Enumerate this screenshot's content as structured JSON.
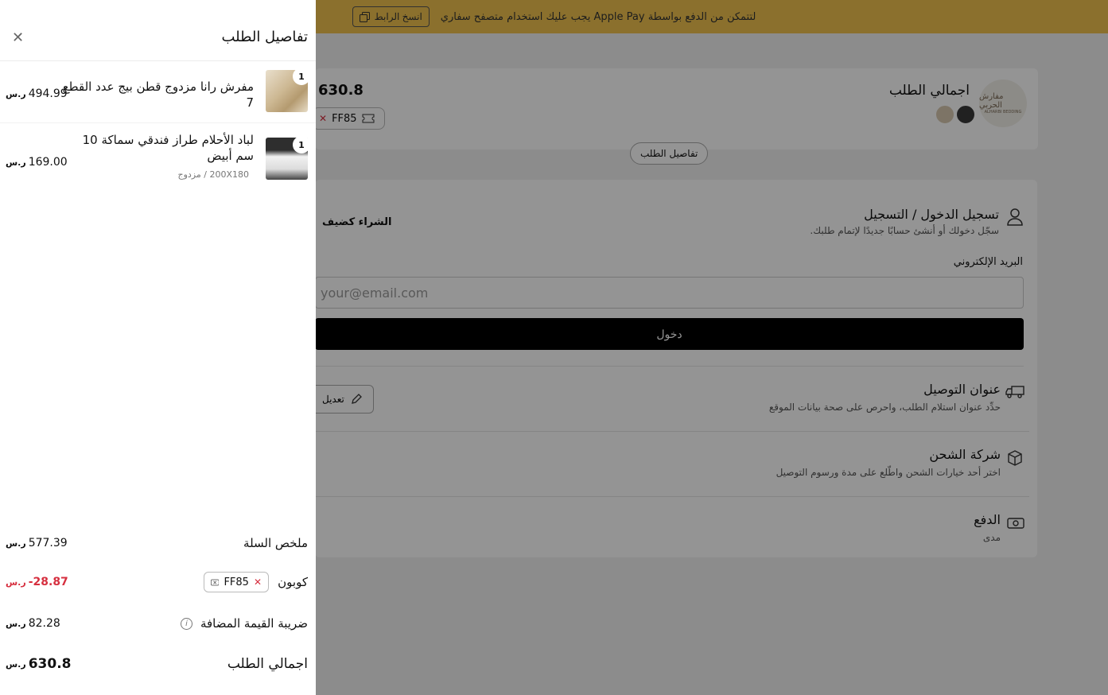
{
  "banner": {
    "message": "لتتمكن من الدفع بواسطة Apple Pay يجب عليك استخدام متصفح سفاري",
    "copy_link": "انسخ الرابط"
  },
  "background": {
    "store_logo_text": "مفارش الحربي",
    "store_logo_subtext": "ALHARBI BEDDING",
    "order_total_label": "اجمالي الطلب",
    "order_total_value": "630.8",
    "coupon_code": "FF85",
    "order_details_button": "تفاصيل الطلب",
    "login_title": "تسجيل الدخول / التسجيل",
    "login_subtitle": "سجّل دخولك أو أنشئ حسابًا جديدًا لإتمام طلبك.",
    "guest_checkout": "الشراء كضيف",
    "email_label": "البريد الإلكتروني",
    "email_placeholder": "your@email.com",
    "login_button": "دخول",
    "address_title": "عنوان التوصيل",
    "address_subtitle": "حدِّد عنوان استلام الطلب، واحرص على صحة بيانات الموقع",
    "edit_button": "تعديل",
    "shipping_title": "شركة الشحن",
    "shipping_subtitle": "اختر أحد خيارات الشحن واطّلع على مدة ورسوم التوصيل",
    "payment_title": "الدفع",
    "payment_subtitle": "مدى"
  },
  "drawer": {
    "title": "تفاصيل الطلب",
    "items": [
      {
        "name": "مفرش رانا مزدوج قطن بيج عدد القطع 7",
        "variant": "",
        "quantity": "1",
        "price": "494.99"
      },
      {
        "name": "لباد الأحلام طراز فندقي سماكة 10 سم أبيض",
        "variant": "200X180 / مزدوج",
        "quantity": "1",
        "price": "169.00"
      }
    ],
    "summary": {
      "subtotal_label": "ملخص السلة",
      "subtotal_value": "577.39",
      "coupon_label": "كوبون",
      "coupon_code": "FF85",
      "coupon_discount": "-28.87",
      "vat_label": "ضريبة القيمة المضافة",
      "vat_value": "82.28",
      "total_label": "اجمالي الطلب",
      "total_value": "630.8"
    },
    "currency_symbol": "ر.س"
  },
  "colors": {
    "banner_bg": "#efc24e",
    "discount_red": "#d62f3f",
    "overlay": "rgba(0,0,0,0.42)",
    "primary_button": "#000000"
  }
}
